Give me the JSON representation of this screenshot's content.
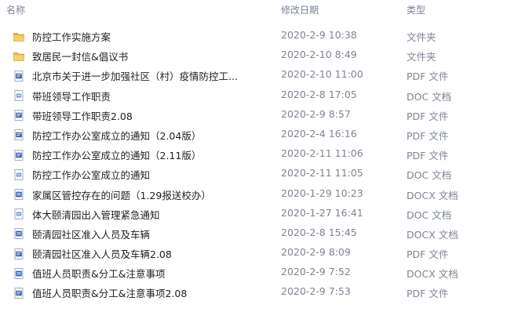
{
  "columns": {
    "name": "名称",
    "date": "修改日期",
    "type": "类型"
  },
  "files": [
    {
      "name": "防控工作实施方案",
      "date": "2020-2-9 10:38",
      "type": "文件夹",
      "icon": "folder-icon"
    },
    {
      "name": "致居民一封信&倡议书",
      "date": "2020-2-10 8:49",
      "type": "文件夹",
      "icon": "folder-icon"
    },
    {
      "name": "北京市关于进一步加强社区（村）疫情防控工...",
      "date": "2020-2-10 11:00",
      "type": "PDF 文件",
      "icon": "pdf-file-icon"
    },
    {
      "name": "带班领导工作职责",
      "date": "2020-2-8 17:05",
      "type": "DOC 文档",
      "icon": "doc-file-icon"
    },
    {
      "name": "带班领导工作职责2.08",
      "date": "2020-2-9 8:57",
      "type": "PDF 文件",
      "icon": "pdf-file-icon"
    },
    {
      "name": "防控工作办公室成立的通知（2.04版）",
      "date": "2020-2-4 16:16",
      "type": "PDF 文件",
      "icon": "pdf-file-icon"
    },
    {
      "name": "防控工作办公室成立的通知（2.11版）",
      "date": "2020-2-11 11:06",
      "type": "PDF 文件",
      "icon": "pdf-file-icon"
    },
    {
      "name": "防控工作办公室成立的通知",
      "date": "2020-2-11 11:05",
      "type": "DOC 文档",
      "icon": "doc-file-icon"
    },
    {
      "name": "家属区管控存在的问题（1.29报送校办）",
      "date": "2020-1-29 10:23",
      "type": "DOCX 文档",
      "icon": "docx-file-icon"
    },
    {
      "name": "体大颐清园出入管理紧急通知",
      "date": "2020-1-27 16:41",
      "type": "DOC 文档",
      "icon": "doc-file-icon"
    },
    {
      "name": "颐清园社区准入人员及车辆",
      "date": "2020-2-8 15:45",
      "type": "DOCX 文档",
      "icon": "docx-file-icon"
    },
    {
      "name": "颐清园社区准入人员及车辆2.08",
      "date": "2020-2-9 8:09",
      "type": "PDF 文件",
      "icon": "pdf-file-icon"
    },
    {
      "name": "值班人员职责&分工&注意事项",
      "date": "2020-2-9 7:52",
      "type": "DOCX 文档",
      "icon": "docx-file-icon"
    },
    {
      "name": "值班人员职责&分工&注意事项2.08",
      "date": "2020-2-9 7:53",
      "type": "PDF 文件",
      "icon": "pdf-file-icon"
    }
  ]
}
